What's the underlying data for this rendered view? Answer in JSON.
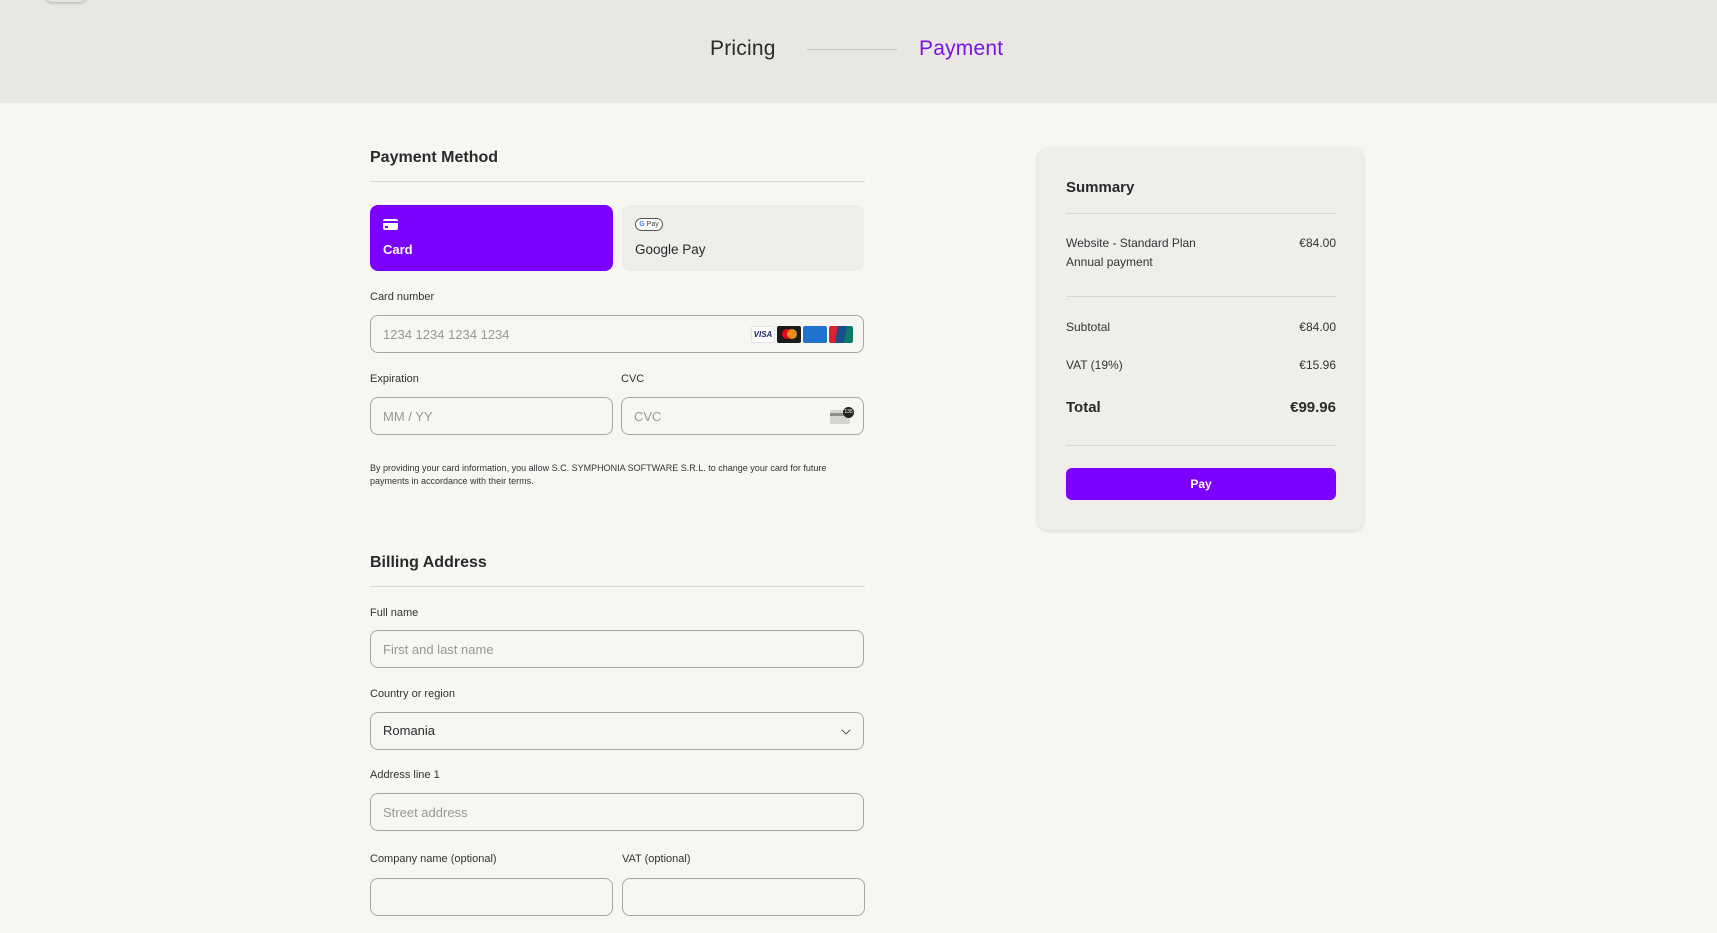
{
  "header": {
    "steps": [
      {
        "label": "Pricing",
        "state": "completed"
      },
      {
        "label": "Payment",
        "state": "active"
      }
    ],
    "active_color": "#7a14e0"
  },
  "payment_method": {
    "title": "Payment Method",
    "options": [
      {
        "label": "Card",
        "icon": "credit-card-icon",
        "selected": true
      },
      {
        "label": "Google Pay",
        "icon": "google-pay-badge-icon",
        "badge_text": "G Pay",
        "selected": false
      }
    ],
    "card_number": {
      "label": "Card number",
      "placeholder": "1234 1234 1234 1234",
      "value": ""
    },
    "card_brands": [
      "VISA",
      "Mastercard",
      "AMEX",
      "UnionPay"
    ],
    "expiration": {
      "label": "Expiration",
      "placeholder": "MM / YY",
      "value": ""
    },
    "cvc": {
      "label": "CVC",
      "placeholder": "CVC",
      "value": "",
      "icon_badge": "135"
    },
    "legal_text": "By providing your card information, you allow S.C. SYMPHONIA SOFTWARE S.R.L. to change your card for future payments in accordance with their terms."
  },
  "billing": {
    "title": "Billing Address",
    "full_name": {
      "label": "Full name",
      "placeholder": "First and last name",
      "value": ""
    },
    "country": {
      "label": "Country or region",
      "value": "Romania"
    },
    "address1": {
      "label": "Address line 1",
      "placeholder": "Street address",
      "value": ""
    },
    "company": {
      "label": "Company name (optional)",
      "placeholder": "",
      "value": ""
    },
    "vat": {
      "label": "VAT (optional)",
      "placeholder": "",
      "value": ""
    }
  },
  "summary": {
    "title": "Summary",
    "item_name": "Website - Standard Plan",
    "item_sub": "Annual payment",
    "item_price": "€84.00",
    "subtotal_label": "Subtotal",
    "subtotal_value": "€84.00",
    "vat_label": "VAT (19%)",
    "vat_value": "€15.96",
    "total_label": "Total",
    "total_value": "€99.96",
    "pay_label": "Pay",
    "accent_color": "#7b00ff"
  }
}
